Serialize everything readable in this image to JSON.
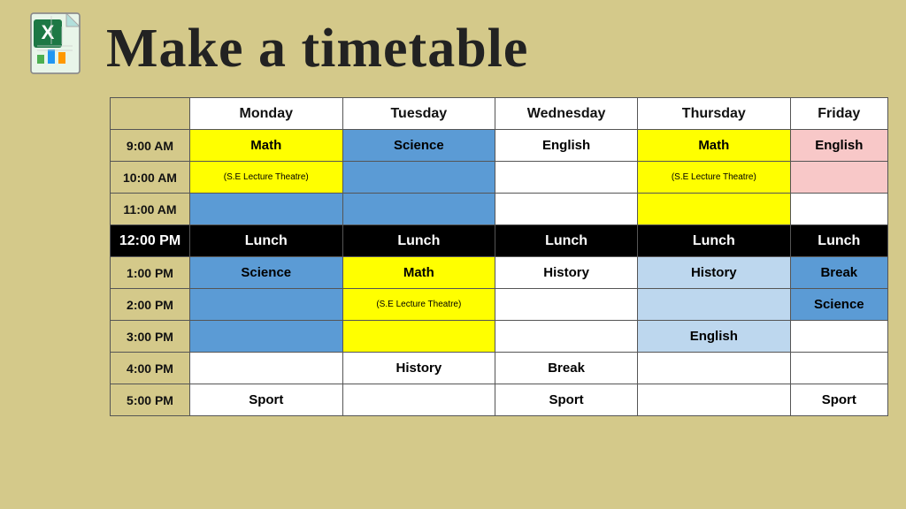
{
  "header": {
    "title": "Make a timetable"
  },
  "table": {
    "days": [
      "Monday",
      "Tuesday",
      "Wednesday",
      "Thursday",
      "Friday"
    ],
    "rows": [
      {
        "time": "9:00 AM",
        "cells": [
          {
            "text": "Math",
            "style": "yellow"
          },
          {
            "text": "Science",
            "style": "blue"
          },
          {
            "text": "English",
            "style": "white"
          },
          {
            "text": "Math",
            "style": "yellow"
          },
          {
            "text": "English",
            "style": "pink"
          }
        ]
      },
      {
        "time": "10:00 AM",
        "cells": [
          {
            "text": "(S.E Lecture Theatre)",
            "style": "yellow",
            "small": true
          },
          {
            "text": "",
            "style": "blue"
          },
          {
            "text": "",
            "style": "white"
          },
          {
            "text": "(S.E Lecture Theatre)",
            "style": "yellow",
            "small": true
          },
          {
            "text": "",
            "style": "pink"
          }
        ]
      },
      {
        "time": "11:00 AM",
        "cells": [
          {
            "text": "",
            "style": "blue"
          },
          {
            "text": "",
            "style": "blue"
          },
          {
            "text": "",
            "style": "white"
          },
          {
            "text": "",
            "style": "yellow"
          },
          {
            "text": "",
            "style": "white"
          }
        ]
      },
      {
        "time": "12:00 PM",
        "isLunch": true,
        "cells": [
          {
            "text": "Lunch"
          },
          {
            "text": "Lunch"
          },
          {
            "text": "Lunch"
          },
          {
            "text": "Lunch"
          },
          {
            "text": "Lunch"
          }
        ]
      },
      {
        "time": "1:00 PM",
        "cells": [
          {
            "text": "Science",
            "style": "blue"
          },
          {
            "text": "Math",
            "style": "yellow"
          },
          {
            "text": "History",
            "style": "white"
          },
          {
            "text": "History",
            "style": "light-blue"
          },
          {
            "text": "Break",
            "style": "blue"
          }
        ]
      },
      {
        "time": "2:00 PM",
        "cells": [
          {
            "text": "",
            "style": "blue"
          },
          {
            "text": "(S.E Lecture Theatre)",
            "style": "yellow",
            "small": true
          },
          {
            "text": "",
            "style": "white"
          },
          {
            "text": "",
            "style": "light-blue"
          },
          {
            "text": "Science",
            "style": "blue"
          }
        ]
      },
      {
        "time": "3:00 PM",
        "cells": [
          {
            "text": "",
            "style": "blue"
          },
          {
            "text": "",
            "style": "yellow"
          },
          {
            "text": "",
            "style": "white"
          },
          {
            "text": "English",
            "style": "light-blue"
          },
          {
            "text": "",
            "style": "white"
          }
        ]
      },
      {
        "time": "4:00 PM",
        "cells": [
          {
            "text": "",
            "style": "white"
          },
          {
            "text": "History",
            "style": "white"
          },
          {
            "text": "Break",
            "style": "white"
          },
          {
            "text": "",
            "style": "white"
          },
          {
            "text": "",
            "style": "white"
          }
        ]
      },
      {
        "time": "5:00 PM",
        "cells": [
          {
            "text": "Sport",
            "style": "white"
          },
          {
            "text": "",
            "style": "white"
          },
          {
            "text": "Sport",
            "style": "white"
          },
          {
            "text": "",
            "style": "white"
          },
          {
            "text": "Sport",
            "style": "white"
          }
        ]
      }
    ]
  }
}
